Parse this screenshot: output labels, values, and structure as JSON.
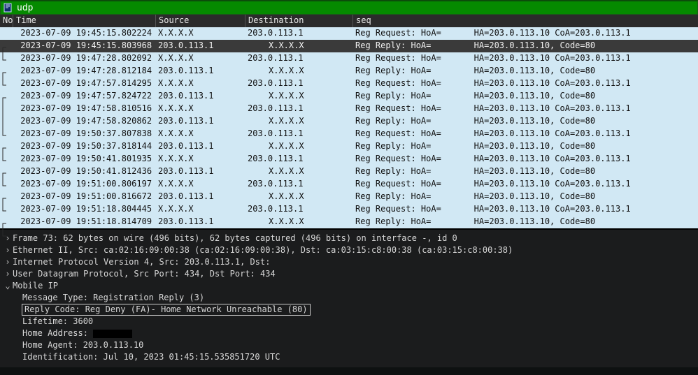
{
  "filter": {
    "value": "udp"
  },
  "columns": {
    "no": "No",
    "time": "Time",
    "src": "Source",
    "dst": "Destination",
    "seq": "seq"
  },
  "rows": [
    {
      "time": "2023-07-09 19:45:15.802224",
      "src": "X.X.X.X",
      "dst": "203.0.113.1",
      "seq1": "Reg Request: HoA=",
      "seq2": "HA=203.0.113.10 CoA=203.0.113.1",
      "sel": false
    },
    {
      "time": "2023-07-09 19:45:15.803968",
      "src": "203.0.113.1",
      "dst": "X.X.X.X",
      "seq1": "Reg Reply: HoA=",
      "seq2": "HA=203.0.113.10, Code=80",
      "sel": true
    },
    {
      "time": "2023-07-09 19:47:28.802092",
      "src": "X.X.X.X",
      "dst": "203.0.113.1",
      "seq1": "Reg Request: HoA=",
      "seq2": "HA=203.0.113.10 CoA=203.0.113.1",
      "sel": false
    },
    {
      "time": "2023-07-09 19:47:28.812184",
      "src": "203.0.113.1",
      "dst": "X.X.X.X",
      "seq1": "Reg Reply: HoA=",
      "seq2": "HA=203.0.113.10, Code=80",
      "sel": false
    },
    {
      "time": "2023-07-09 19:47:57.814295",
      "src": "X.X.X.X",
      "dst": "203.0.113.1",
      "seq1": "Reg Request: HoA=",
      "seq2": "HA=203.0.113.10 CoA=203.0.113.1",
      "sel": false
    },
    {
      "time": "2023-07-09 19:47:57.824722",
      "src": "203.0.113.1",
      "dst": "X.X.X.X",
      "seq1": "Reg Reply: HoA=",
      "seq2": "HA=203.0.113.10, Code=80",
      "sel": false
    },
    {
      "time": "2023-07-09 19:47:58.810516",
      "src": "X.X.X.X",
      "dst": "203.0.113.1",
      "seq1": "Reg Request: HoA=",
      "seq2": "HA=203.0.113.10 CoA=203.0.113.1",
      "sel": false
    },
    {
      "time": "2023-07-09 19:47:58.820862",
      "src": "203.0.113.1",
      "dst": "X.X.X.X",
      "seq1": "Reg Reply: HoA=",
      "seq2": "HA=203.0.113.10, Code=80",
      "sel": false
    },
    {
      "time": "2023-07-09 19:50:37.807838",
      "src": "X.X.X.X",
      "dst": "203.0.113.1",
      "seq1": "Reg Request: HoA=",
      "seq2": "HA=203.0.113.10 CoA=203.0.113.1",
      "sel": false
    },
    {
      "time": "2023-07-09 19:50:37.818144",
      "src": "203.0.113.1",
      "dst": "X.X.X.X",
      "seq1": "Reg Reply: HoA=",
      "seq2": "HA=203.0.113.10, Code=80",
      "sel": false
    },
    {
      "time": "2023-07-09 19:50:41.801935",
      "src": "X.X.X.X",
      "dst": "203.0.113.1",
      "seq1": "Reg Request: HoA=",
      "seq2": "HA=203.0.113.10 CoA=203.0.113.1",
      "sel": false
    },
    {
      "time": "2023-07-09 19:50:41.812436",
      "src": "203.0.113.1",
      "dst": "X.X.X.X",
      "seq1": "Reg Reply: HoA=",
      "seq2": "HA=203.0.113.10, Code=80",
      "sel": false
    },
    {
      "time": "2023-07-09 19:51:00.806197",
      "src": "X.X.X.X",
      "dst": "203.0.113.1",
      "seq1": "Reg Request: HoA=",
      "seq2": "HA=203.0.113.10 CoA=203.0.113.1",
      "sel": false
    },
    {
      "time": "2023-07-09 19:51:00.816672",
      "src": "203.0.113.1",
      "dst": "X.X.X.X",
      "seq1": "Reg Reply: HoA=",
      "seq2": "HA=203.0.113.10, Code=80",
      "sel": false
    },
    {
      "time": "2023-07-09 19:51:18.804445",
      "src": "X.X.X.X",
      "dst": "203.0.113.1",
      "seq1": "Reg Request: HoA=",
      "seq2": "HA=203.0.113.10 CoA=203.0.113.1",
      "sel": false
    },
    {
      "time": "2023-07-09 19:51:18.814709",
      "src": "203.0.113.1",
      "dst": "X.X.X.X",
      "seq1": "Reg Reply: HoA=",
      "seq2": "HA=203.0.113.10, Code=80",
      "sel": false
    }
  ],
  "details": {
    "frame": "Frame 73: 62 bytes on wire (496 bits), 62 bytes captured (496 bits) on interface -, id 0",
    "eth": "Ethernet II, Src: ca:02:16:09:00:38 (ca:02:16:09:00:38), Dst: ca:03:15:c8:00:38 (ca:03:15:c8:00:38)",
    "ip": "Internet Protocol Version 4, Src: 203.0.113.1, Dst:",
    "udp": "User Datagram Protocol, Src Port: 434, Dst Port: 434",
    "mip": "Mobile IP",
    "msgtype": "Message Type: Registration Reply (3)",
    "replycode": "Reply Code: Reg Deny (FA)- Home Network Unreachable (80)",
    "lifetime": "Lifetime: 3600",
    "homeaddr": "Home Address: ",
    "homeagent": "Home Agent: 203.0.113.10",
    "ident": "Identification: Jul 10, 2023 01:45:15.535851720 UTC"
  },
  "glyphs": {
    "closed": "›",
    "open": "⌄"
  }
}
